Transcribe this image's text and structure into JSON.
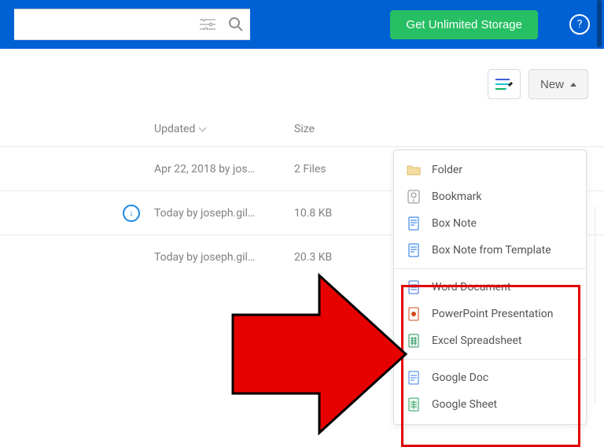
{
  "header": {
    "search_placeholder": "",
    "upgrade_label": "Get Unlimited Storage"
  },
  "toolbar": {
    "new_label": "New"
  },
  "columns": {
    "updated": "Updated",
    "size": "Size"
  },
  "rows": [
    {
      "updated": "Apr 22, 2018 by jos…",
      "size": "2 Files",
      "sync": false
    },
    {
      "updated": "Today by joseph.gil…",
      "size": "10.8 KB",
      "sync": true
    },
    {
      "updated": "Today by joseph.gil…",
      "size": "20.3 KB",
      "sync": false
    }
  ],
  "new_menu": {
    "group1": [
      {
        "id": "folder",
        "label": "Folder"
      },
      {
        "id": "bookmark",
        "label": "Bookmark"
      },
      {
        "id": "box-note",
        "label": "Box Note"
      },
      {
        "id": "box-note-template",
        "label": "Box Note from Template"
      }
    ],
    "group2": [
      {
        "id": "word",
        "label": "Word Document"
      },
      {
        "id": "ppt",
        "label": "PowerPoint Presentation"
      },
      {
        "id": "excel",
        "label": "Excel Spreadsheet"
      }
    ],
    "group3": [
      {
        "id": "gdoc",
        "label": "Google Doc"
      },
      {
        "id": "gsheet",
        "label": "Google Sheet"
      }
    ]
  }
}
